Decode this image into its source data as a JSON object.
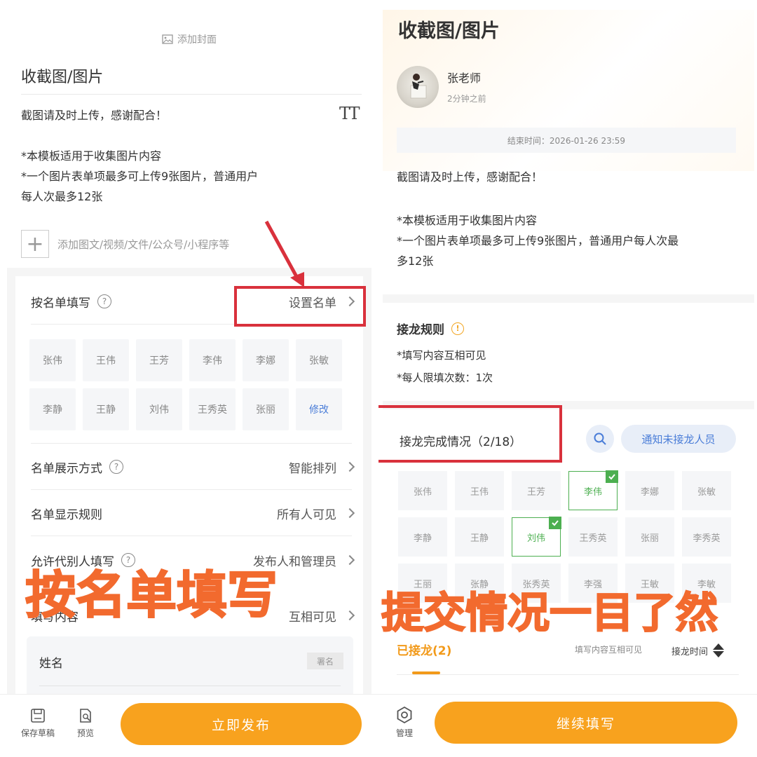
{
  "left": {
    "add_cover": "添加封面",
    "title": "收截图/图片",
    "desc_lines": [
      "截图请及时上传，感谢配合！",
      "",
      "*本模板适用于收集图片内容",
      "*一个图片表单项最多可上传9张图片，普通用户",
      "每人次最多12张"
    ],
    "add_content": "添加图文/视频/文件/公众号/小程序等",
    "roster": {
      "label": "按名单填写",
      "action": "设置名单"
    },
    "names": [
      "张伟",
      "王伟",
      "王芳",
      "李伟",
      "李娜",
      "张敏",
      "李静",
      "王静",
      "刘伟",
      "王秀英",
      "张丽",
      "修改"
    ],
    "settings": [
      {
        "label": "名单展示方式",
        "value": "智能排列"
      },
      {
        "label": "名单显示规则",
        "value": "所有人可见"
      },
      {
        "label": "允许代别人填写",
        "value": "发布人和管理员"
      },
      {
        "label": "填写内容",
        "value": "互相可见"
      }
    ],
    "field_name": "姓名",
    "anonymous": "署名",
    "bottom": {
      "save": "保存草稿",
      "preview": "预览",
      "publish": "立即发布"
    },
    "overlay": "按名单填写"
  },
  "right": {
    "title": "收截图/图片",
    "author": "张老师",
    "time": "2分钟之前",
    "deadline": "结束时间：2026-01-26 23:59",
    "desc_lines": [
      "截图请及时上传，感谢配合！",
      "",
      "*本模板适用于收集图片内容",
      "*一个图片表单项最多可上传9张图片，普通用户每人次最",
      "多12张"
    ],
    "rules_title": "接龙规则",
    "rules": [
      "*填写内容互相可见",
      "*每人限填次数：1次"
    ],
    "status": "接龙完成情况（2/18）",
    "notify": "通知未接龙人员",
    "names": [
      "张伟",
      "王伟",
      "王芳",
      "李伟",
      "李娜",
      "张敏",
      "李静",
      "王静",
      "刘伟",
      "王秀英",
      "张丽",
      "李秀英",
      "王丽",
      "张静",
      "张秀英",
      "李强",
      "王敏",
      "李敏"
    ],
    "done": [
      3,
      8
    ],
    "tab_active": "已接龙(2)",
    "tab_visibility": "填写内容互相可见",
    "tab_sort": "接龙时间",
    "bottom": {
      "manage": "管理",
      "continue": "继续填写"
    },
    "overlay": "提交情况一目了然"
  },
  "colors": {
    "accent": "#f8a21e",
    "highlight": "#d9313c",
    "overlay": "#f26a2e",
    "done": "#4caf50",
    "link": "#4a7dd8"
  }
}
